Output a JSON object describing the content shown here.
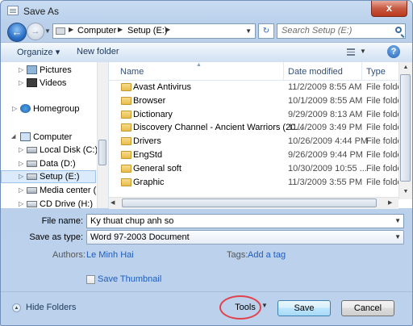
{
  "window": {
    "title": "Save As",
    "close_glyph": "x"
  },
  "address": {
    "crumbs": [
      "Computer",
      "Setup (E:)"
    ],
    "search_placeholder": "Search Setup (E:)"
  },
  "toolbar": {
    "organize": "Organize ▾",
    "new_folder": "New folder"
  },
  "nav": {
    "items": [
      {
        "label": "Pictures",
        "icon": "pictures-icon"
      },
      {
        "label": "Videos",
        "icon": "videos-icon"
      },
      {
        "label": "Homegroup",
        "icon": "homegroup-icon"
      },
      {
        "label": "Computer",
        "icon": "computer-icon"
      },
      {
        "label": "Local Disk (C:)",
        "icon": "drive-icon"
      },
      {
        "label": "Data (D:)",
        "icon": "drive-icon"
      },
      {
        "label": "Setup (E:)",
        "icon": "drive-icon",
        "selected": true
      },
      {
        "label": "Media center (F:)",
        "icon": "drive-icon"
      },
      {
        "label": "CD Drive (H:)",
        "icon": "cd-drive-icon"
      }
    ]
  },
  "columns": {
    "name": "Name",
    "date": "Date modified",
    "type": "Type"
  },
  "files": [
    {
      "name": "Avast Antivirus",
      "date": "11/2/2009 8:55 AM",
      "type": "File folde"
    },
    {
      "name": "Browser",
      "date": "10/1/2009 8:55 AM",
      "type": "File folde"
    },
    {
      "name": "Dictionary",
      "date": "9/29/2009 8:13 AM",
      "type": "File folde"
    },
    {
      "name": "Discovery Channel - Ancient Warriors (20...",
      "date": "11/4/2009 3:49 PM",
      "type": "File folde"
    },
    {
      "name": "Drivers",
      "date": "10/26/2009 4:44 PM",
      "type": "File folde"
    },
    {
      "name": "EngStd",
      "date": "9/26/2009 9:44 PM",
      "type": "File folde"
    },
    {
      "name": "General soft",
      "date": "10/30/2009 10:55 ...",
      "type": "File folde"
    },
    {
      "name": "Graphic",
      "date": "11/3/2009 3:55 PM",
      "type": "File folde"
    }
  ],
  "form": {
    "file_name_label": "File name:",
    "file_name_value": "Ky thuat chup anh so",
    "save_type_label": "Save as type:",
    "save_type_value": "Word 97-2003 Document",
    "authors_label": "Authors:",
    "authors_value": "Le Minh Hai",
    "tags_label": "Tags:",
    "tags_value": "Add a tag",
    "thumbnail_label": "Save Thumbnail"
  },
  "footer": {
    "hide_folders": "Hide Folders",
    "tools": "Tools",
    "save": "Save",
    "cancel": "Cancel"
  },
  "colors": {
    "accent": "#1e5dbf",
    "highlight_circle": "#e0434d",
    "close": "#c75a42"
  }
}
